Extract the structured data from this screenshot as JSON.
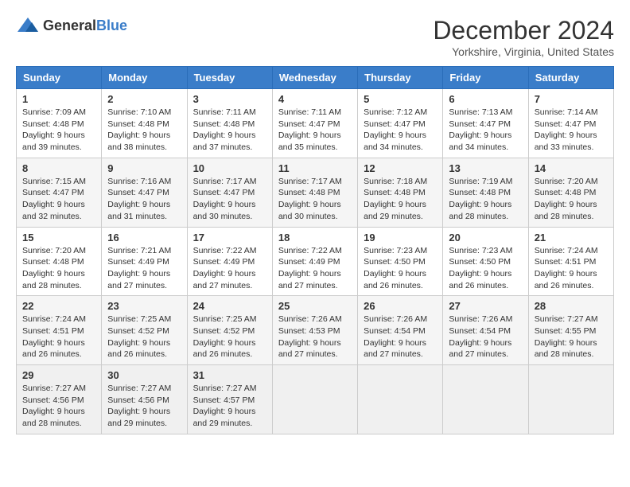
{
  "logo": {
    "text_general": "General",
    "text_blue": "Blue"
  },
  "title": "December 2024",
  "subtitle": "Yorkshire, Virginia, United States",
  "days_header": [
    "Sunday",
    "Monday",
    "Tuesday",
    "Wednesday",
    "Thursday",
    "Friday",
    "Saturday"
  ],
  "weeks": [
    [
      {
        "day": "1",
        "sunrise": "Sunrise: 7:09 AM",
        "sunset": "Sunset: 4:48 PM",
        "daylight": "Daylight: 9 hours",
        "minutes": "and 39 minutes."
      },
      {
        "day": "2",
        "sunrise": "Sunrise: 7:10 AM",
        "sunset": "Sunset: 4:48 PM",
        "daylight": "Daylight: 9 hours",
        "minutes": "and 38 minutes."
      },
      {
        "day": "3",
        "sunrise": "Sunrise: 7:11 AM",
        "sunset": "Sunset: 4:48 PM",
        "daylight": "Daylight: 9 hours",
        "minutes": "and 37 minutes."
      },
      {
        "day": "4",
        "sunrise": "Sunrise: 7:11 AM",
        "sunset": "Sunset: 4:47 PM",
        "daylight": "Daylight: 9 hours",
        "minutes": "and 35 minutes."
      },
      {
        "day": "5",
        "sunrise": "Sunrise: 7:12 AM",
        "sunset": "Sunset: 4:47 PM",
        "daylight": "Daylight: 9 hours",
        "minutes": "and 34 minutes."
      },
      {
        "day": "6",
        "sunrise": "Sunrise: 7:13 AM",
        "sunset": "Sunset: 4:47 PM",
        "daylight": "Daylight: 9 hours",
        "minutes": "and 34 minutes."
      },
      {
        "day": "7",
        "sunrise": "Sunrise: 7:14 AM",
        "sunset": "Sunset: 4:47 PM",
        "daylight": "Daylight: 9 hours",
        "minutes": "and 33 minutes."
      }
    ],
    [
      {
        "day": "8",
        "sunrise": "Sunrise: 7:15 AM",
        "sunset": "Sunset: 4:47 PM",
        "daylight": "Daylight: 9 hours",
        "minutes": "and 32 minutes."
      },
      {
        "day": "9",
        "sunrise": "Sunrise: 7:16 AM",
        "sunset": "Sunset: 4:47 PM",
        "daylight": "Daylight: 9 hours",
        "minutes": "and 31 minutes."
      },
      {
        "day": "10",
        "sunrise": "Sunrise: 7:17 AM",
        "sunset": "Sunset: 4:47 PM",
        "daylight": "Daylight: 9 hours",
        "minutes": "and 30 minutes."
      },
      {
        "day": "11",
        "sunrise": "Sunrise: 7:17 AM",
        "sunset": "Sunset: 4:48 PM",
        "daylight": "Daylight: 9 hours",
        "minutes": "and 30 minutes."
      },
      {
        "day": "12",
        "sunrise": "Sunrise: 7:18 AM",
        "sunset": "Sunset: 4:48 PM",
        "daylight": "Daylight: 9 hours",
        "minutes": "and 29 minutes."
      },
      {
        "day": "13",
        "sunrise": "Sunrise: 7:19 AM",
        "sunset": "Sunset: 4:48 PM",
        "daylight": "Daylight: 9 hours",
        "minutes": "and 28 minutes."
      },
      {
        "day": "14",
        "sunrise": "Sunrise: 7:20 AM",
        "sunset": "Sunset: 4:48 PM",
        "daylight": "Daylight: 9 hours",
        "minutes": "and 28 minutes."
      }
    ],
    [
      {
        "day": "15",
        "sunrise": "Sunrise: 7:20 AM",
        "sunset": "Sunset: 4:48 PM",
        "daylight": "Daylight: 9 hours",
        "minutes": "and 28 minutes."
      },
      {
        "day": "16",
        "sunrise": "Sunrise: 7:21 AM",
        "sunset": "Sunset: 4:49 PM",
        "daylight": "Daylight: 9 hours",
        "minutes": "and 27 minutes."
      },
      {
        "day": "17",
        "sunrise": "Sunrise: 7:22 AM",
        "sunset": "Sunset: 4:49 PM",
        "daylight": "Daylight: 9 hours",
        "minutes": "and 27 minutes."
      },
      {
        "day": "18",
        "sunrise": "Sunrise: 7:22 AM",
        "sunset": "Sunset: 4:49 PM",
        "daylight": "Daylight: 9 hours",
        "minutes": "and 27 minutes."
      },
      {
        "day": "19",
        "sunrise": "Sunrise: 7:23 AM",
        "sunset": "Sunset: 4:50 PM",
        "daylight": "Daylight: 9 hours",
        "minutes": "and 26 minutes."
      },
      {
        "day": "20",
        "sunrise": "Sunrise: 7:23 AM",
        "sunset": "Sunset: 4:50 PM",
        "daylight": "Daylight: 9 hours",
        "minutes": "and 26 minutes."
      },
      {
        "day": "21",
        "sunrise": "Sunrise: 7:24 AM",
        "sunset": "Sunset: 4:51 PM",
        "daylight": "Daylight: 9 hours",
        "minutes": "and 26 minutes."
      }
    ],
    [
      {
        "day": "22",
        "sunrise": "Sunrise: 7:24 AM",
        "sunset": "Sunset: 4:51 PM",
        "daylight": "Daylight: 9 hours",
        "minutes": "and 26 minutes."
      },
      {
        "day": "23",
        "sunrise": "Sunrise: 7:25 AM",
        "sunset": "Sunset: 4:52 PM",
        "daylight": "Daylight: 9 hours",
        "minutes": "and 26 minutes."
      },
      {
        "day": "24",
        "sunrise": "Sunrise: 7:25 AM",
        "sunset": "Sunset: 4:52 PM",
        "daylight": "Daylight: 9 hours",
        "minutes": "and 26 minutes."
      },
      {
        "day": "25",
        "sunrise": "Sunrise: 7:26 AM",
        "sunset": "Sunset: 4:53 PM",
        "daylight": "Daylight: 9 hours",
        "minutes": "and 27 minutes."
      },
      {
        "day": "26",
        "sunrise": "Sunrise: 7:26 AM",
        "sunset": "Sunset: 4:54 PM",
        "daylight": "Daylight: 9 hours",
        "minutes": "and 27 minutes."
      },
      {
        "day": "27",
        "sunrise": "Sunrise: 7:26 AM",
        "sunset": "Sunset: 4:54 PM",
        "daylight": "Daylight: 9 hours",
        "minutes": "and 27 minutes."
      },
      {
        "day": "28",
        "sunrise": "Sunrise: 7:27 AM",
        "sunset": "Sunset: 4:55 PM",
        "daylight": "Daylight: 9 hours",
        "minutes": "and 28 minutes."
      }
    ],
    [
      {
        "day": "29",
        "sunrise": "Sunrise: 7:27 AM",
        "sunset": "Sunset: 4:56 PM",
        "daylight": "Daylight: 9 hours",
        "minutes": "and 28 minutes."
      },
      {
        "day": "30",
        "sunrise": "Sunrise: 7:27 AM",
        "sunset": "Sunset: 4:56 PM",
        "daylight": "Daylight: 9 hours",
        "minutes": "and 29 minutes."
      },
      {
        "day": "31",
        "sunrise": "Sunrise: 7:27 AM",
        "sunset": "Sunset: 4:57 PM",
        "daylight": "Daylight: 9 hours",
        "minutes": "and 29 minutes."
      },
      null,
      null,
      null,
      null
    ]
  ]
}
